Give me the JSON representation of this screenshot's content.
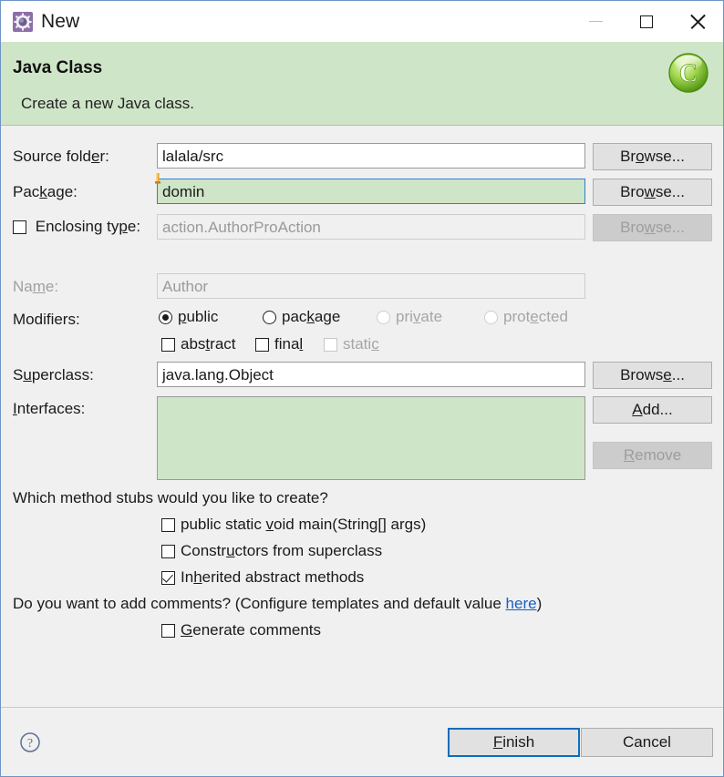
{
  "window": {
    "title": "New",
    "icon": "wizard-cog-icon",
    "controls": {
      "minimize": "minimize-icon",
      "maximize": "maximize-icon",
      "close": "close-icon"
    }
  },
  "header": {
    "title": "Java Class",
    "subtitle": "Create a new Java class.",
    "icon": "java-class-wizard-icon",
    "background_color": "#cfe5c8"
  },
  "form": {
    "source_folder": {
      "label_pre": "Source fold",
      "label_mn": "e",
      "label_post": "r:",
      "value": "lalala/src",
      "browse_pre": "Br",
      "browse_mn": "o",
      "browse_post": "wse..."
    },
    "package": {
      "label_pre": "Pac",
      "label_mn": "k",
      "label_post": "age:",
      "value": "domin",
      "browse_pre": "Bro",
      "browse_mn": "w",
      "browse_post": "se..."
    },
    "enclosing_type": {
      "label_pre": "Enclosing ty",
      "label_mn": "p",
      "label_post": "e:",
      "value": "action.AuthorProAction",
      "browse_pre": "Bro",
      "browse_mn": "w",
      "browse_post": "se..."
    },
    "name": {
      "label_pre": "Na",
      "label_mn": "m",
      "label_post": "e:",
      "value": "Author"
    },
    "modifiers": {
      "label": "Modifiers:",
      "radios": [
        {
          "pre": "",
          "mn": "p",
          "post": "ublic",
          "selected": true,
          "disabled": false
        },
        {
          "pre": "pac",
          "mn": "k",
          "post": "age",
          "selected": false,
          "disabled": false
        },
        {
          "pre": "pri",
          "mn": "v",
          "post": "ate",
          "selected": false,
          "disabled": true
        },
        {
          "pre": "prot",
          "mn": "e",
          "post": "cted",
          "selected": false,
          "disabled": true
        }
      ],
      "checkboxes": [
        {
          "pre": "abs",
          "mn": "t",
          "post": "ract",
          "checked": false,
          "disabled": false
        },
        {
          "pre": "fina",
          "mn": "l",
          "post": "",
          "checked": false,
          "disabled": false
        },
        {
          "pre": "stati",
          "mn": "c",
          "post": "",
          "checked": false,
          "disabled": true
        }
      ]
    },
    "superclass": {
      "label_pre": "S",
      "label_mn": "u",
      "label_post": "perclass:",
      "value": "java.lang.Object",
      "browse_pre": "Brows",
      "browse_mn": "e",
      "browse_post": "..."
    },
    "interfaces": {
      "label_pre": "",
      "label_mn": "I",
      "label_post": "nterfaces:",
      "items": [],
      "add_pre": "",
      "add_mn": "A",
      "add_post": "dd...",
      "remove_pre": "",
      "remove_mn": "R",
      "remove_post": "emove"
    }
  },
  "stubs": {
    "question": "Which method stubs would you like to create?",
    "options": [
      {
        "pre": "public static ",
        "mn": "v",
        "post": "oid main(String[] args)",
        "checked": false
      },
      {
        "pre": "Constr",
        "mn": "u",
        "post": "ctors from superclass",
        "checked": false
      },
      {
        "pre": "In",
        "mn": "h",
        "post": "erited abstract methods",
        "checked": true
      }
    ]
  },
  "comments": {
    "question_pre": "Do you want to add comments? (Configure templates and default value ",
    "link": "here",
    "question_post": ")",
    "option": {
      "pre": "",
      "mn": "G",
      "post": "enerate comments",
      "checked": false
    }
  },
  "footer": {
    "help_icon": "help-icon",
    "finish_pre": "",
    "finish_mn": "F",
    "finish_post": "inish",
    "cancel": "Cancel"
  }
}
